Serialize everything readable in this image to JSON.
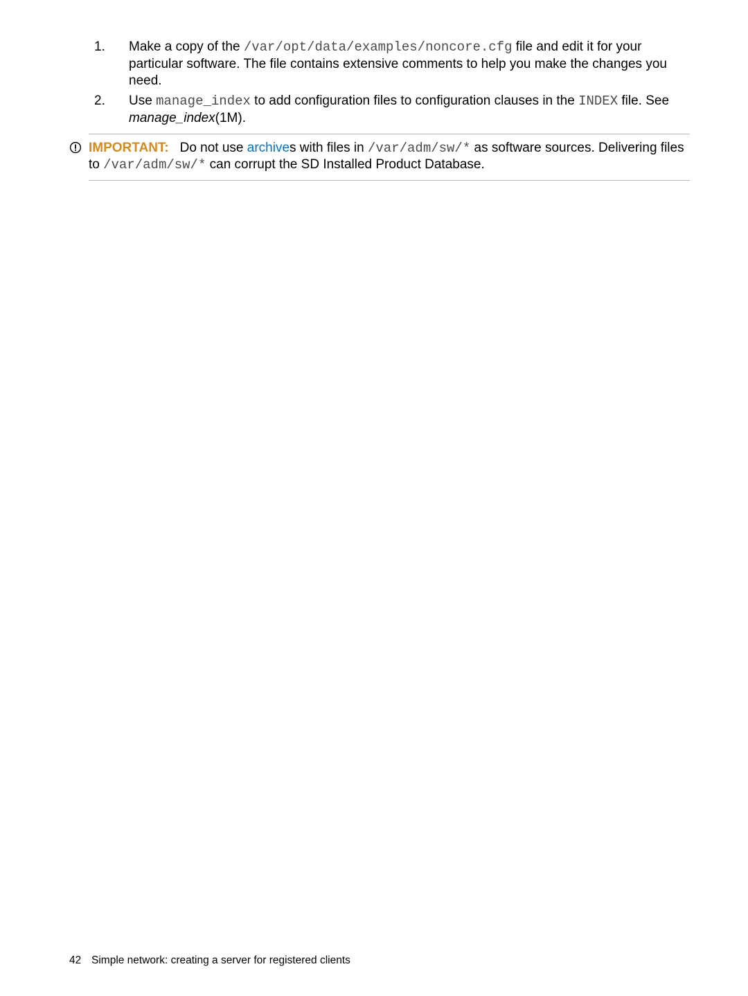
{
  "list": {
    "items": [
      {
        "num": "1.",
        "pre": "Make a copy of the ",
        "code": "/var/opt/data/examples/noncore.cfg",
        "post": " file and edit it for your particular software. The file contains extensive comments to help you make the changes you need."
      },
      {
        "num": "2.",
        "pre": "Use ",
        "code1": "manage_index",
        "mid": " to add configuration files to configuration clauses in the ",
        "code2": "INDEX",
        "post": " file. See ",
        "ref": "manage_index",
        "ref_suffix": "(1M)."
      }
    ]
  },
  "callout": {
    "label": "IMPORTANT:",
    "t1": "Do not use ",
    "link": "archive",
    "t2": "s with files in ",
    "path1": "/var/adm/sw/*",
    "t3": " as software sources. Delivering files to ",
    "path2": "/var/adm/sw/*",
    "t4": " can corrupt the SD Installed Product Database."
  },
  "footer": {
    "page": "42",
    "title": "Simple network: creating a server for registered clients"
  }
}
